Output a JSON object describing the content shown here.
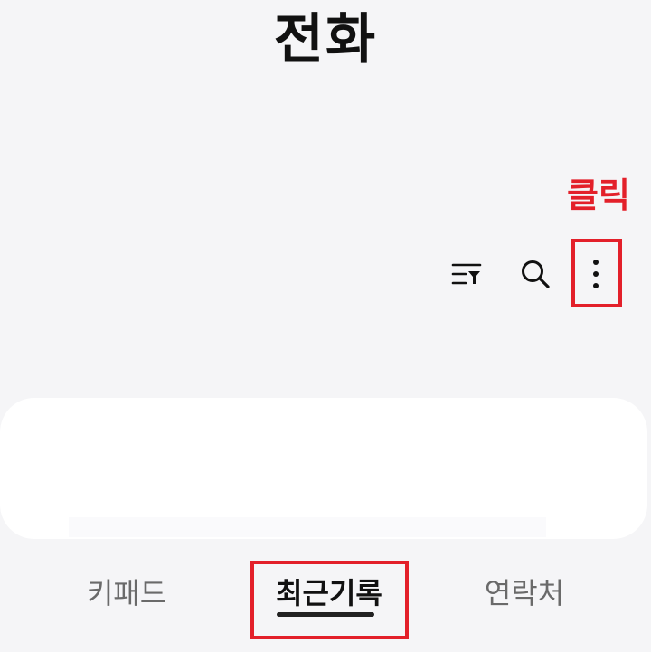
{
  "header": {
    "title": "전화"
  },
  "annotation": {
    "label": "클릭",
    "color": "#e3202a"
  },
  "toolbar": {
    "icons": {
      "filter": "filter-list-icon",
      "search": "search-icon",
      "more": "more-vertical-icon"
    }
  },
  "bottom_nav": {
    "tabs": [
      {
        "label": "키패드"
      },
      {
        "label": "최근기록",
        "selected": true
      },
      {
        "label": "연락처"
      }
    ]
  },
  "colors": {
    "background": "#f5f5f7",
    "card": "#ffffff",
    "highlight": "#e3202a",
    "text_primary": "#111111",
    "text_secondary": "#6a6a6a"
  }
}
